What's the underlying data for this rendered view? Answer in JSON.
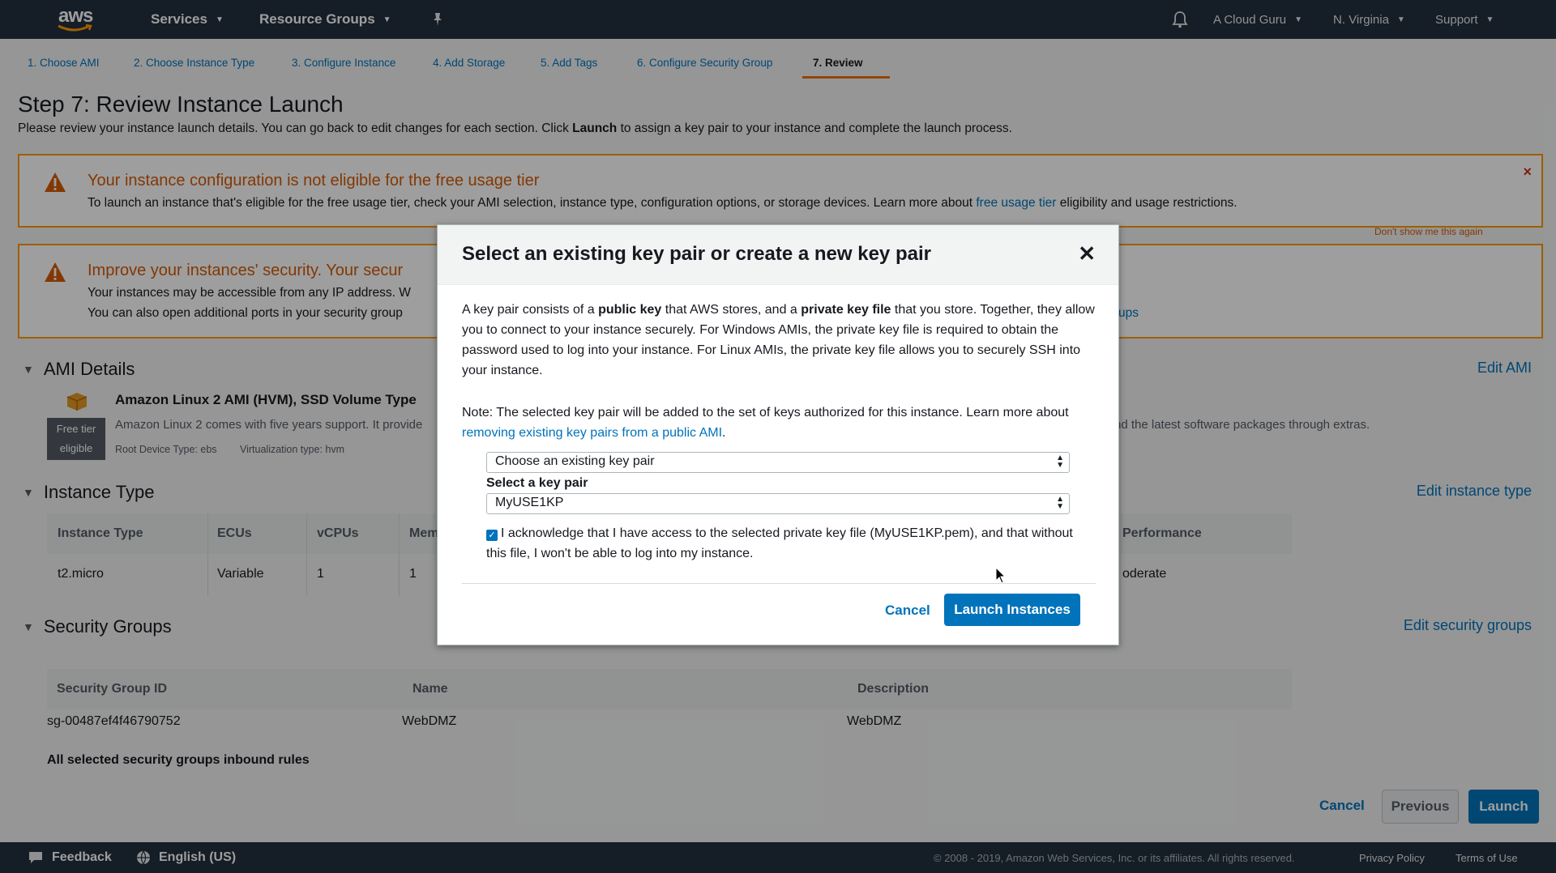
{
  "nav": {
    "logo": "aws",
    "services": "Services",
    "resource_groups": "Resource Groups",
    "account": "A Cloud Guru",
    "region": "N. Virginia",
    "support": "Support"
  },
  "tabs": [
    "1. Choose AMI",
    "2. Choose Instance Type",
    "3. Configure Instance",
    "4. Add Storage",
    "5. Add Tags",
    "6. Configure Security Group",
    "7. Review"
  ],
  "page": {
    "title": "Step 7: Review Instance Launch",
    "desc_before": "Please review your instance launch details. You can go back to edit changes for each section. Click ",
    "desc_bold": "Launch",
    "desc_after": " to assign a key pair to your instance and complete the launch process."
  },
  "alert1": {
    "title": "Your instance configuration is not eligible for the free usage tier",
    "text_before": "To launch an instance that's eligible for the free usage tier, check your AMI selection, instance type, configuration options, or storage devices. Learn more about ",
    "link": "free usage tier",
    "text_after": " eligibility and usage restrictions.",
    "close": "×",
    "dont_show": "Don't show me this again"
  },
  "alert2": {
    "title": "Improve your instances' security. Your secur",
    "line1": "Your instances may be accessible from any IP address. W",
    "line2": "You can also open additional ports in your security group",
    "link_tail": "ups"
  },
  "ami": {
    "header": "AMI Details",
    "edit": "Edit AMI",
    "name": "Amazon Linux 2 AMI (HVM), SSD Volume Type",
    "desc": "Amazon Linux 2 comes with five years support. It provide",
    "desc_right": "nd the latest software packages through extras.",
    "free_tier_1": "Free tier",
    "free_tier_2": "eligible",
    "root_device": "Root Device Type: ebs",
    "virt": "Virtualization type: hvm"
  },
  "instance_type": {
    "header": "Instance Type",
    "edit": "Edit instance type",
    "columns": [
      "Instance Type",
      "ECUs",
      "vCPUs",
      "Mem",
      "Performance"
    ],
    "row": [
      "t2.micro",
      "Variable",
      "1",
      "1",
      "oderate"
    ]
  },
  "security_groups": {
    "header": "Security Groups",
    "edit": "Edit security groups",
    "columns": [
      "Security Group ID",
      "Name",
      "Description"
    ],
    "row": [
      "sg-00487ef4f46790752",
      "WebDMZ",
      "WebDMZ"
    ],
    "footer": "All selected security groups inbound rules"
  },
  "bottom": {
    "cancel": "Cancel",
    "previous": "Previous",
    "launch": "Launch"
  },
  "footer": {
    "feedback": "Feedback",
    "language": "English (US)",
    "copyright": "© 2008 - 2019, Amazon Web Services, Inc. or its affiliates. All rights reserved.",
    "privacy": "Privacy Policy",
    "terms": "Terms of Use"
  },
  "modal": {
    "title": "Select an existing key pair or create a new key pair",
    "close": "✕",
    "p1_a": "A key pair consists of a ",
    "p1_b": "public key",
    "p1_c": " that AWS stores, and a ",
    "p1_d": "private key file",
    "p1_e": " that you store. Together, they allow you to connect to your instance securely. For Windows AMIs, the private key file is required to obtain the password used to log into your instance. For Linux AMIs, the private key file allows you to securely SSH into your instance.",
    "note_a": "Note: The selected key pair will be added to the set of keys authorized for this instance. Learn more about ",
    "note_link": "removing existing key pairs from a public AMI",
    "note_b": ".",
    "select1": "Choose an existing key pair",
    "select_label": "Select a key pair",
    "select2": "MyUSE1KP",
    "ack": "I acknowledge that I have access to the selected private key file (MyUSE1KP.pem), and that without this file, I won't be able to log into my instance.",
    "ack_checked": true,
    "cancel": "Cancel",
    "launch": "Launch Instances"
  },
  "colors": {
    "nav_bg": "#232f3e",
    "link": "#0073bb",
    "warning_orange": "#ff9900",
    "warning_text": "#d45b07",
    "primary_button": "#0073bb"
  }
}
